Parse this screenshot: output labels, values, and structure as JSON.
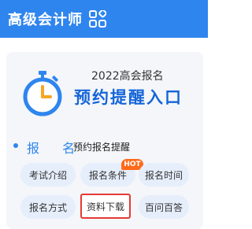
{
  "header": {
    "title": "高级会计师",
    "icon": "apps-grid-icon"
  },
  "banner": {
    "year_text": "2022高会报名",
    "headline": "预约提醒入口",
    "icon": "stopwatch-icon"
  },
  "section": {
    "title": "报 名",
    "link": "预约报名提醒"
  },
  "tags": [
    {
      "label": "考试介绍"
    },
    {
      "label": "报名条件",
      "badge": "HOT"
    },
    {
      "label": "报名时间"
    },
    {
      "label": "报名方式"
    },
    {
      "label": "资料下载",
      "highlighted": true
    },
    {
      "label": "百问百答"
    }
  ],
  "colors": {
    "primary": "#2f85ee",
    "headline": "#1565d8",
    "hot": "#ff6a1a",
    "highlight_border": "#e53935",
    "stopwatch_orange": "#f5a623"
  }
}
